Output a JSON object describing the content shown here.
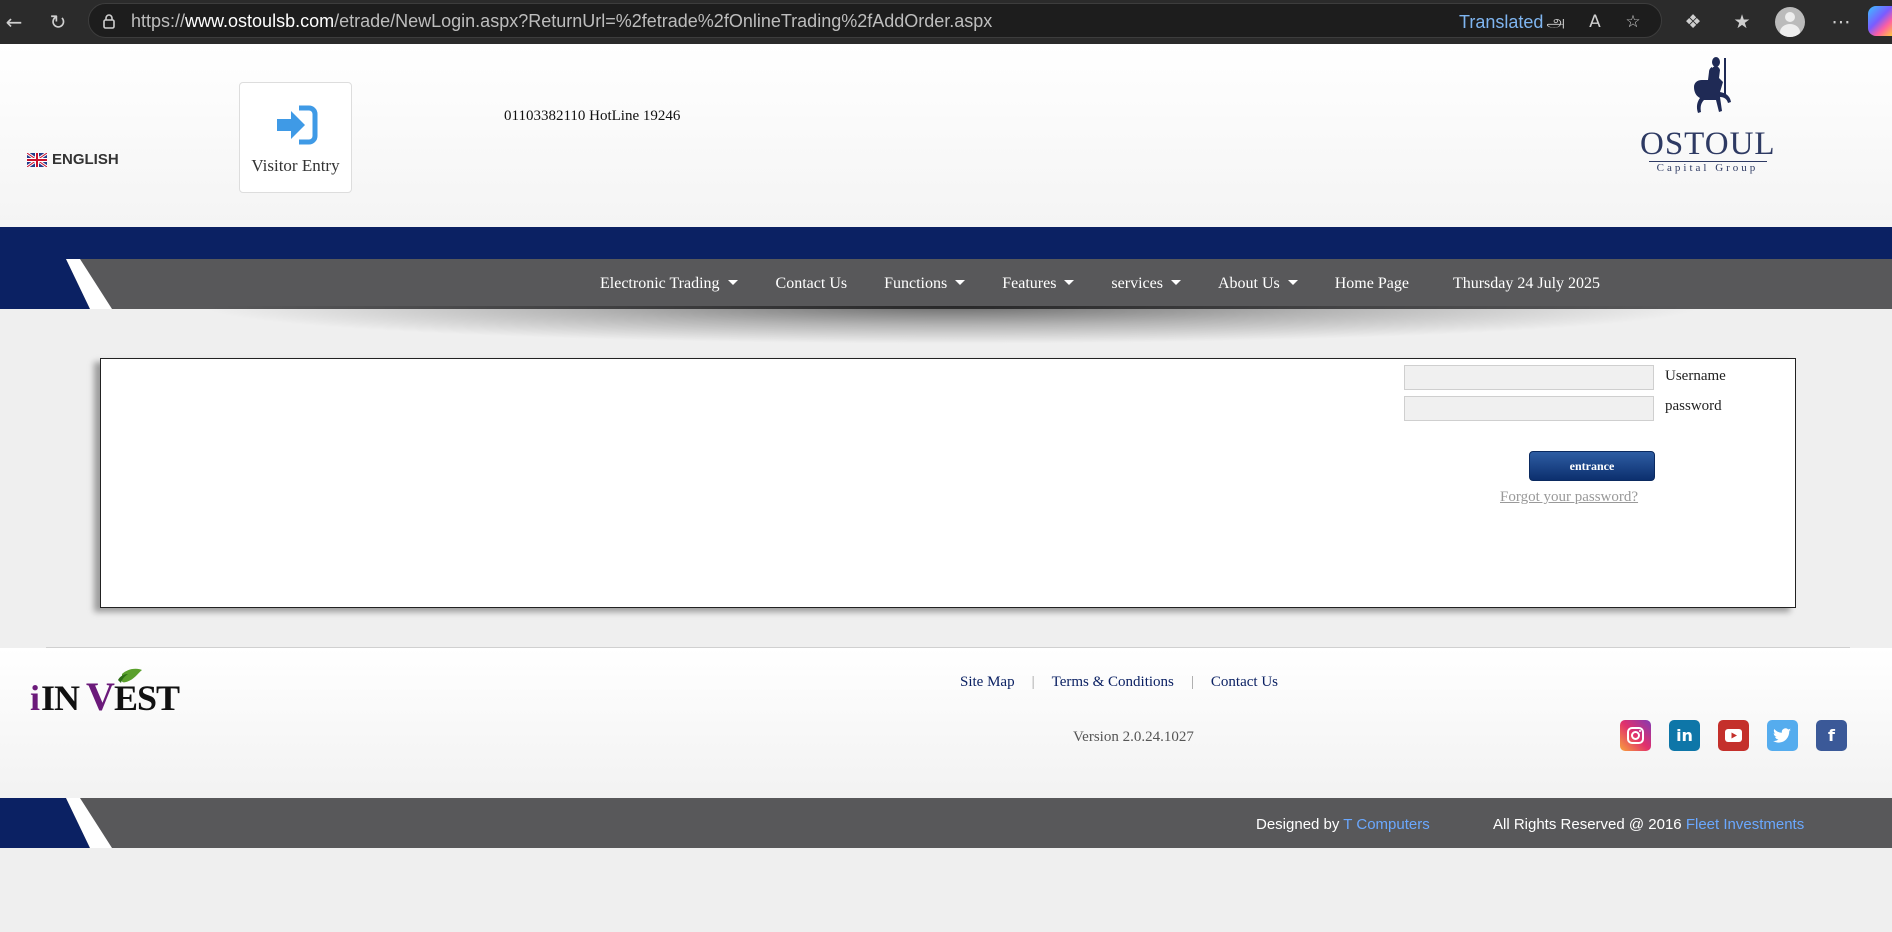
{
  "browser": {
    "url_prefix": "https://",
    "url_host": "www.ostoulsb.com",
    "url_path": "/etrade/NewLogin.aspx?ReturnUrl=%2fetrade%2fOnlineTrading%2fAddOrder.aspx",
    "translated_label": "Translated"
  },
  "header": {
    "language": "ENGLISH",
    "visitor_entry": "Visitor Entry",
    "hotline": "01103382110 HotLine 19246",
    "logo_name": "OSTOUL",
    "logo_sub": "Capital Group"
  },
  "nav": {
    "items": [
      {
        "label": "Electronic Trading",
        "dropdown": true
      },
      {
        "label": "Contact Us",
        "dropdown": false
      },
      {
        "label": "Functions",
        "dropdown": true
      },
      {
        "label": "Features",
        "dropdown": true
      },
      {
        "label": "services",
        "dropdown": true
      },
      {
        "label": "About Us",
        "dropdown": true
      },
      {
        "label": "Home Page",
        "dropdown": false
      }
    ],
    "date": "Thursday 24 July 2025"
  },
  "login": {
    "username_label": "Username",
    "username_value": "",
    "password_label": "password",
    "password_value": "",
    "submit_label": "entrance",
    "forgot_label": "Forgot your password?"
  },
  "footer": {
    "brand": "iINVEST",
    "links": [
      "Site Map",
      "Terms & Conditions",
      "Contact Us"
    ],
    "version": "Version  2.0.24.1027",
    "social": [
      "instagram-icon",
      "linkedin-icon",
      "youtube-icon",
      "twitter-icon",
      "facebook-icon"
    ],
    "designed_by_prefix": "Designed by ",
    "designed_by_link": "T Computers",
    "rights_prefix": "All Rights Reserved @ 2016 ",
    "rights_link": "Fleet Investments"
  },
  "colors": {
    "navy": "#0b2163",
    "nav_gray": "#58585a",
    "button_blue": "#1a4589",
    "link_blue": "#6aa8ff"
  }
}
